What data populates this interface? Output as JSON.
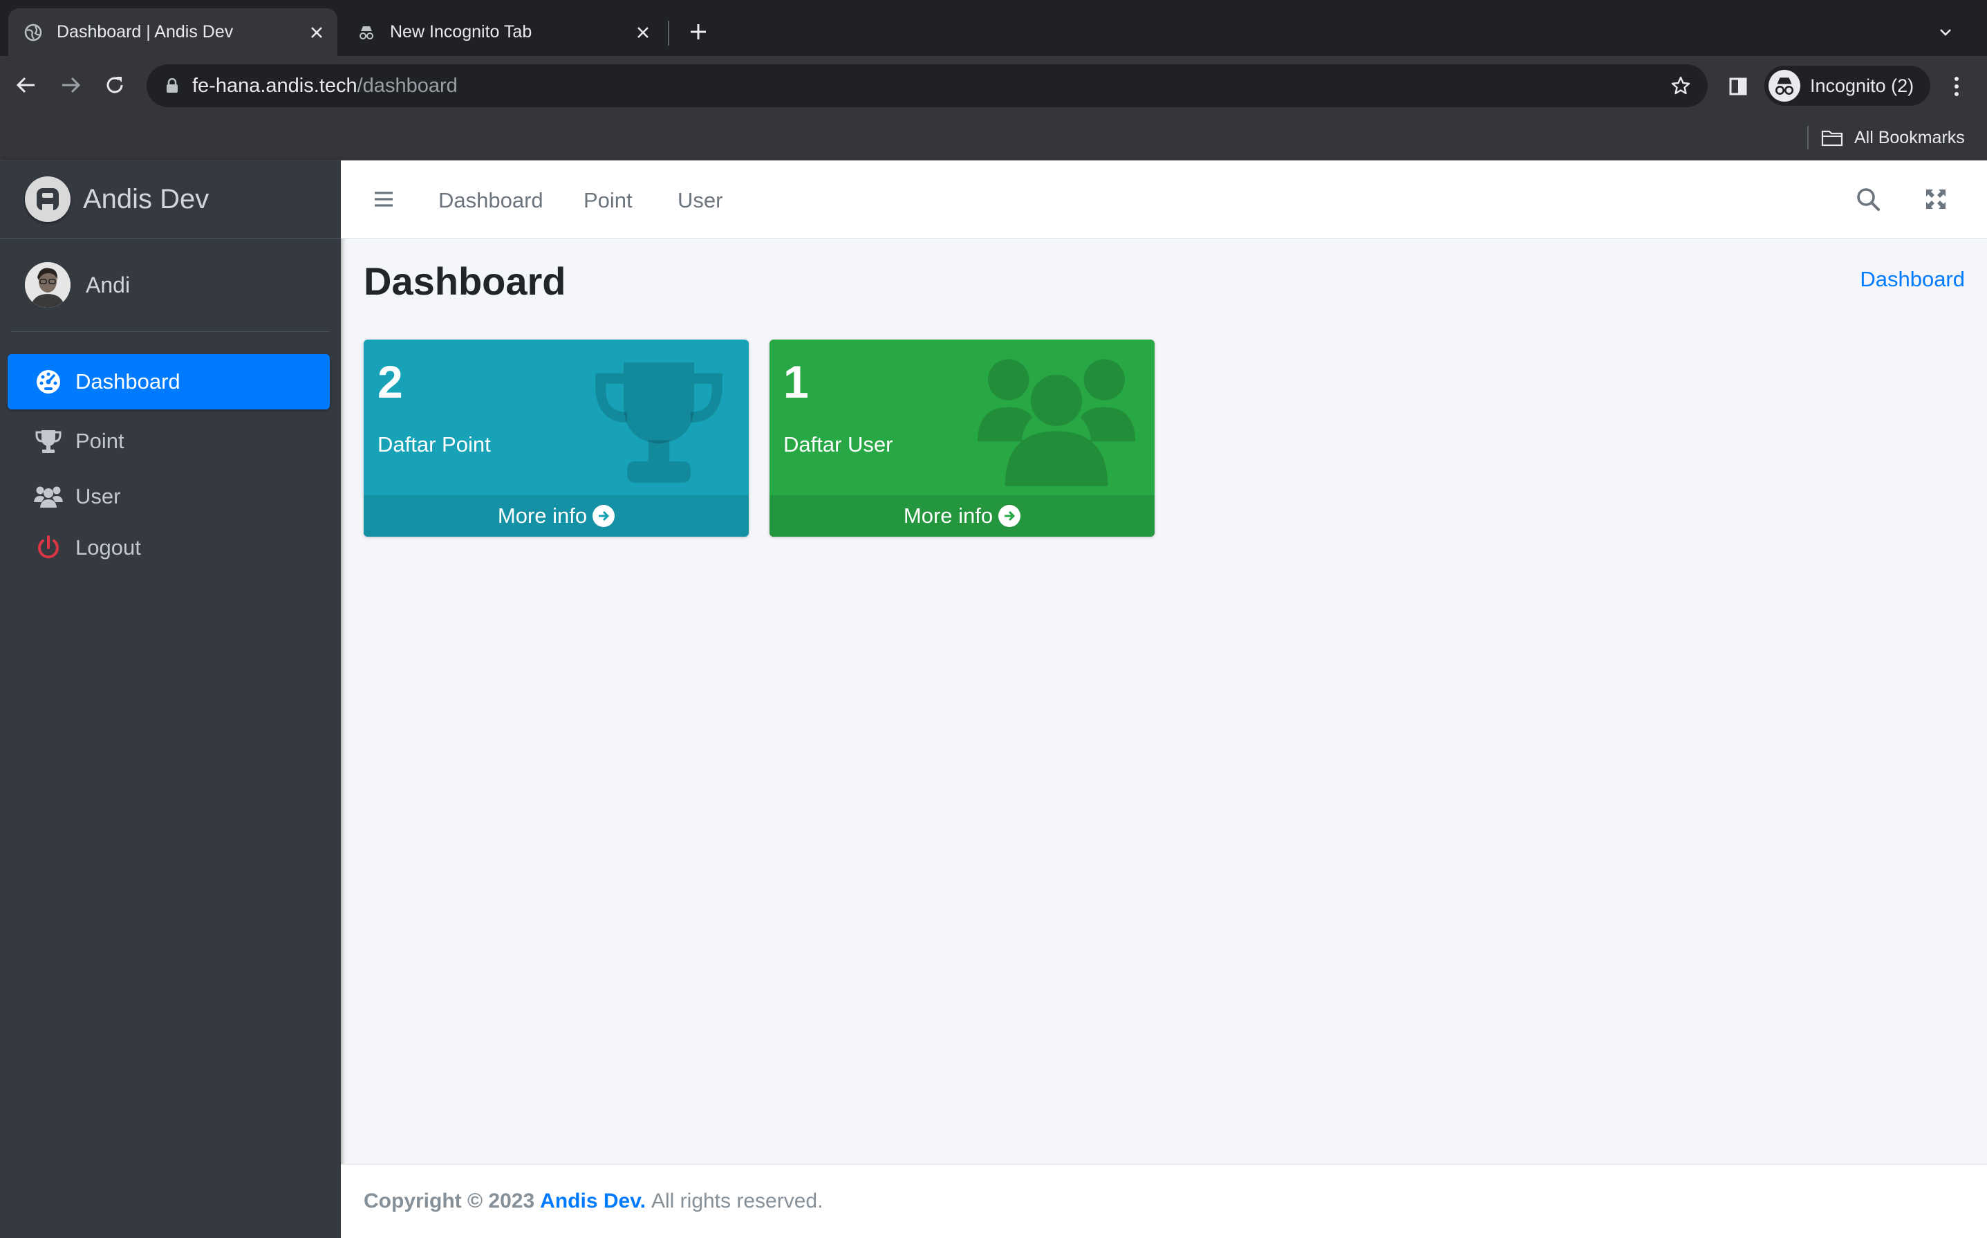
{
  "browser": {
    "tabs": [
      {
        "title": "Dashboard | Andis Dev",
        "active": true
      },
      {
        "title": "New Incognito Tab",
        "active": false
      }
    ],
    "url_host": "fe-hana.andis.tech",
    "url_path": "/dashboard",
    "profile_label": "Incognito (2)",
    "bookmarks_label": "All Bookmarks"
  },
  "sidebar": {
    "brand": "Andis Dev",
    "user_name": "Andi",
    "items": [
      {
        "label": "Dashboard",
        "icon": "tachometer-icon",
        "active": true
      },
      {
        "label": "Point",
        "icon": "trophy-icon",
        "active": false
      },
      {
        "label": "User",
        "icon": "users-icon",
        "active": false
      },
      {
        "label": "Logout",
        "icon": "power-icon",
        "active": false
      }
    ]
  },
  "topnav": {
    "links": [
      "Dashboard",
      "Point",
      "User"
    ]
  },
  "content": {
    "title": "Dashboard",
    "breadcrumb": "Dashboard",
    "boxes": [
      {
        "number": "2",
        "label": "Daftar Point",
        "more": "More info",
        "color": "#17a2b8",
        "icon": "trophy-icon"
      },
      {
        "number": "1",
        "label": "Daftar User",
        "more": "More info",
        "color": "#28a745",
        "icon": "users-icon"
      }
    ]
  },
  "footer": {
    "copyright": "Copyright © 2023",
    "brand": "Andis Dev.",
    "rights": "All rights reserved."
  },
  "colors": {
    "primary": "#007bff",
    "info": "#17a2b8",
    "success": "#28a745",
    "danger": "#dc3545",
    "sidebar": "#343a40"
  }
}
